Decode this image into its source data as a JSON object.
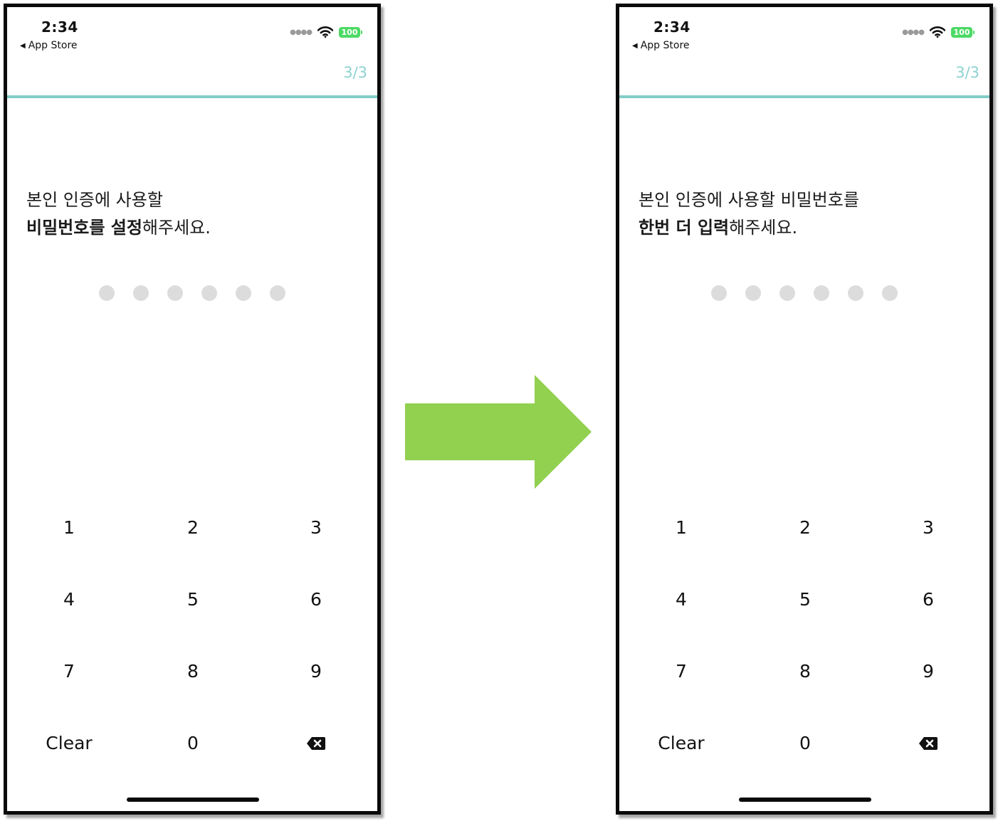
{
  "screens": [
    {
      "status": {
        "time": "2:34",
        "back_label": "App Store",
        "battery": "100"
      },
      "step": "3/3",
      "progress_fraction": 1.0,
      "prompt": {
        "line1": "본인 인증에 사용할",
        "line2_bold": "비밀번호를 설정",
        "line2_rest": "해주세요."
      },
      "pin_length": 6,
      "keypad": [
        "1",
        "2",
        "3",
        "4",
        "5",
        "6",
        "7",
        "8",
        "9",
        "Clear",
        "0",
        "backspace"
      ]
    },
    {
      "status": {
        "time": "2:34",
        "back_label": "App Store",
        "battery": "100"
      },
      "step": "3/3",
      "progress_fraction": 1.0,
      "prompt": {
        "line1": "본인 인증에 사용할 비밀번호를",
        "line2_bold": "한번 더 입력",
        "line2_rest": "해주세요."
      },
      "pin_length": 6,
      "keypad": [
        "1",
        "2",
        "3",
        "4",
        "5",
        "6",
        "7",
        "8",
        "9",
        "Clear",
        "0",
        "backspace"
      ]
    }
  ],
  "colors": {
    "accent": "#80cdc8",
    "step_text": "#8dd3d0",
    "pin_dot_empty": "#dcdcdc",
    "battery": "#4cd964",
    "arrow": "#92d050"
  },
  "icons": {
    "back": "triangle-left-icon",
    "signal": "signal-dots-icon",
    "wifi": "wifi-icon",
    "battery": "battery-icon",
    "backspace": "backspace-icon",
    "transition": "right-arrow-icon"
  }
}
